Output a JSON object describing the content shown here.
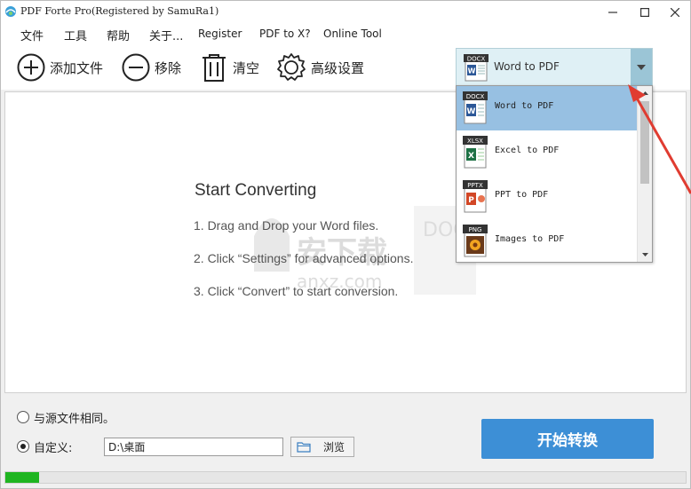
{
  "window": {
    "title": "PDF Forte Pro(Registered by SamuRa1)"
  },
  "menu": {
    "items": [
      "文件",
      "工具",
      "帮助",
      "关于...",
      "Register",
      "PDF to X?",
      "Online Tool"
    ]
  },
  "toolbar": {
    "add_label": "添加文件",
    "remove_label": "移除",
    "clear_label": "清空",
    "settings_label": "高级设置"
  },
  "format_select": {
    "selected": "Word to PDF",
    "selected_badge": "DOCX",
    "options": [
      {
        "label": "Word to PDF",
        "badge": "DOCX"
      },
      {
        "label": "Excel to PDF",
        "badge": "XLSX"
      },
      {
        "label": "PPT to PDF",
        "badge": "PPTX"
      },
      {
        "label": "Images to PDF",
        "badge": "PNG"
      }
    ]
  },
  "main": {
    "title": "Start Converting",
    "steps": [
      "1. Drag and Drop your Word files.",
      "2. Click “Settings” for advanced options.",
      "3. Click “Convert” to start conversion."
    ]
  },
  "watermark": {
    "badge": "DOC",
    "text": "安下载",
    "url": "anxz.com"
  },
  "output": {
    "same_as_source_label": "与源文件相同。",
    "custom_label": "自定义:",
    "path_value": "D:\\桌面",
    "browse_label": "浏览",
    "selected": "custom"
  },
  "convert": {
    "label": "开始转换"
  },
  "progress": {
    "percent": 5
  },
  "colors": {
    "accent": "#3d8fd6",
    "progress": "#1fb521",
    "selection": "#97c0e2",
    "annotation": "#e03c31"
  }
}
